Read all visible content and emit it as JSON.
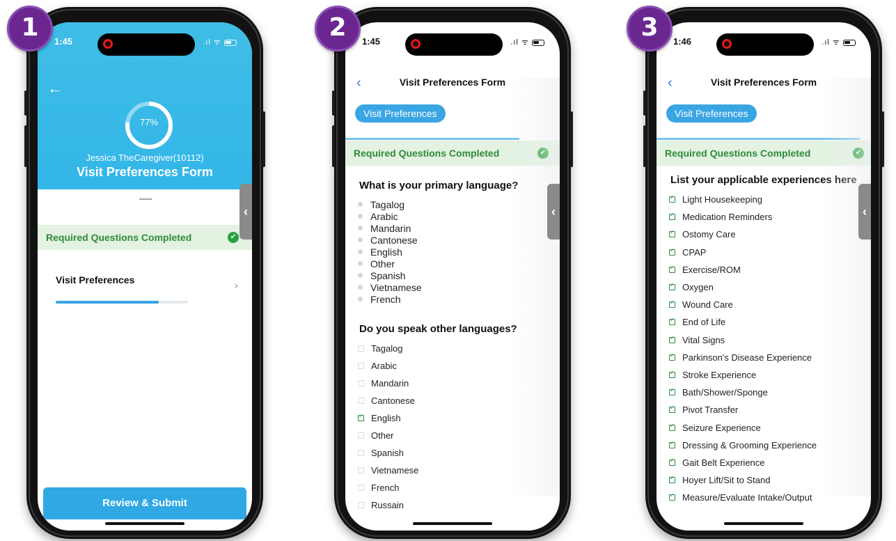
{
  "phones": [
    {
      "step": "1",
      "time": "1:45",
      "progress_percent_label": "77%",
      "progress_fraction": 0.77,
      "caregiver": "Jessica TheCaregiver(10112)",
      "title": "Visit Preferences Form",
      "required_status": "Required Questions Completed",
      "section_label": "Visit Preferences",
      "section_progress_fraction": 0.78,
      "submit_label": "Review & Submit"
    },
    {
      "step": "2",
      "time": "1:45",
      "title": "Visit Preferences Form",
      "section_pill": "Visit Preferences",
      "required_status": "Required Questions Completed",
      "question1": "What is your primary language?",
      "q1_options": [
        "Tagalog",
        "Arabic",
        "Mandarin",
        "Cantonese",
        "English",
        "Other",
        "Spanish",
        "Vietnamese",
        "French"
      ],
      "question2": "Do you speak other languages?",
      "q2_options": [
        {
          "label": "Tagalog",
          "checked": false
        },
        {
          "label": "Arabic",
          "checked": false
        },
        {
          "label": "Mandarin",
          "checked": false
        },
        {
          "label": "Cantonese",
          "checked": false
        },
        {
          "label": "English",
          "checked": true
        },
        {
          "label": "Other",
          "checked": false
        },
        {
          "label": "Spanish",
          "checked": false
        },
        {
          "label": "Vietnamese",
          "checked": false
        },
        {
          "label": "French",
          "checked": false
        },
        {
          "label": "Russain",
          "checked": false
        }
      ]
    },
    {
      "step": "3",
      "time": "1:46",
      "title": "Visit Preferences Form",
      "section_pill": "Visit Preferences",
      "required_status": "Required Questions Completed",
      "question": "List your applicable experiences here",
      "options": [
        {
          "label": "Light Housekeeping",
          "checked": true
        },
        {
          "label": "Medication Reminders",
          "checked": true
        },
        {
          "label": "Ostomy Care",
          "checked": true
        },
        {
          "label": "CPAP",
          "checked": true
        },
        {
          "label": "Exercise/ROM",
          "checked": true
        },
        {
          "label": "Oxygen",
          "checked": true
        },
        {
          "label": "Wound Care",
          "checked": true
        },
        {
          "label": "End of Life",
          "checked": true
        },
        {
          "label": "Vital Signs",
          "checked": true
        },
        {
          "label": "Parkinson's Disease Experience",
          "checked": true
        },
        {
          "label": "Stroke Experience",
          "checked": true
        },
        {
          "label": "Bath/Shower/Sponge",
          "checked": true
        },
        {
          "label": "Pivot Transfer",
          "checked": true
        },
        {
          "label": "Seizure Experience",
          "checked": true
        },
        {
          "label": "Dressing & Grooming Experience",
          "checked": true
        },
        {
          "label": "Gait Belt Experience",
          "checked": true
        },
        {
          "label": "Hoyer Lift/Sit to Stand",
          "checked": true
        },
        {
          "label": "Measure/Evaluate Intake/Output",
          "checked": true
        }
      ]
    }
  ],
  "colors": {
    "badge": "#6a2790",
    "header_blue": "#33b6e8",
    "accent_blue": "#3aa5e3",
    "success_green": "#2aa23d",
    "success_bg": "#e3f2e1",
    "nav_blue": "#2f7fe6"
  }
}
